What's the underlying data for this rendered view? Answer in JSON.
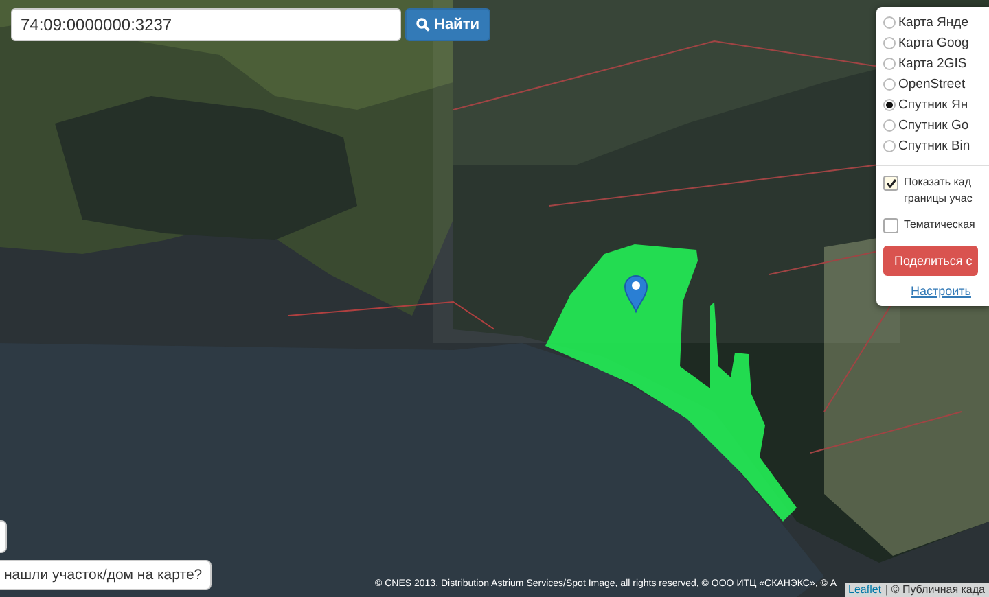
{
  "search": {
    "value": "74:09:0000000:3237",
    "button": "Найти"
  },
  "layers": {
    "options": [
      {
        "label": "Карта Янде",
        "selected": false
      },
      {
        "label": "Карта Goog",
        "selected": false
      },
      {
        "label": "Карта 2GIS",
        "selected": false
      },
      {
        "label": "OpenStreet",
        "selected": false
      },
      {
        "label": "Спутник Ян",
        "selected": true
      },
      {
        "label": "Спутник Go",
        "selected": false
      },
      {
        "label": "Спутник Bin",
        "selected": false
      }
    ],
    "toggles": [
      {
        "lines": [
          "Показать кад",
          "границы учас"
        ],
        "checked": true
      },
      {
        "lines": [
          "Тематическая"
        ],
        "checked": false
      }
    ],
    "share_button": "Поделиться с",
    "settings_link": "Настроить"
  },
  "help_button": "нашли участок/дом на карте?",
  "attribution": "© CNES 2013, Distribution Astrium Services/Spot Image, all rights reserved, © ООО ИТЦ «СКАНЭКС», © A",
  "leaflet_attribution": {
    "link": "Leaflet",
    "text": "| © Публичная када"
  }
}
